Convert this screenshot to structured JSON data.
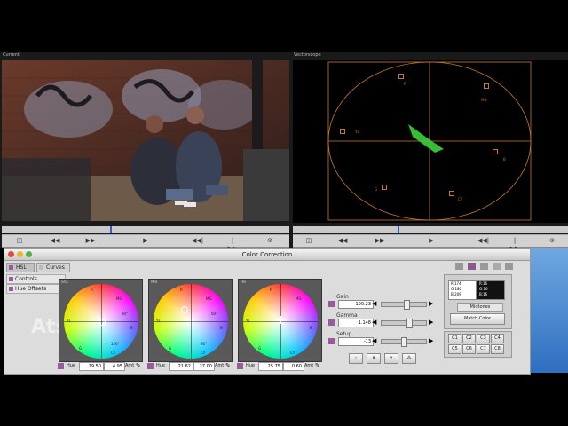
{
  "viewer": {
    "current_label": "Current",
    "vectorscope_label": "Vectorscope"
  },
  "controls": {
    "left": [
      "◫",
      "◀◀",
      "▶▶",
      "▶",
      "◀◀|",
      "|▶▶",
      "⊘"
    ],
    "right": [
      "◫",
      "◀◀",
      "▶▶",
      "▶",
      "◀◀|",
      "|▶▶",
      "⊘"
    ]
  },
  "color_correction": {
    "title": "Color Correction",
    "tabs": {
      "hsl": "HSL",
      "curves": "Curves"
    },
    "sidebar": {
      "controls": "Controls",
      "hue_offsets": "Hue Offsets"
    },
    "wheels": [
      {
        "label": "Sha",
        "hue_label": "Hue",
        "hue": "29.50",
        "amt": "4.95",
        "amt_label": "Amt"
      },
      {
        "label": "Mid",
        "hue_label": "Hue",
        "hue": "21.62",
        "amt": "27.00",
        "amt_label": "Amt"
      },
      {
        "label": "Hili",
        "hue_label": "Hue",
        "hue": "25.75",
        "amt": "0.60",
        "amt_label": "Amt"
      }
    ],
    "wheel_marks": {
      "r": "R",
      "mg": "MG",
      "yl": "YL",
      "cy": "CY",
      "g": "G",
      "b": "B",
      "deg30": "30°",
      "deg60": "60°",
      "deg90": "90°",
      "deg120": "120°"
    },
    "sliders": {
      "gain": {
        "label": "Gain",
        "value": "100.23"
      },
      "gamma": {
        "label": "Gamma",
        "value": "1.148"
      },
      "setup": {
        "label": "Setup",
        "value": "-13"
      }
    },
    "rgb_readout": {
      "left": [
        "R:174",
        "G:180",
        "B:209"
      ],
      "right": [
        "R:16",
        "G:16",
        "B:16"
      ]
    },
    "midtones_select": "Midtones",
    "match_color": "Match Color",
    "c_buttons": [
      "C1",
      "C2",
      "C3",
      "C4",
      "C5",
      "C6",
      "C7",
      "C8"
    ],
    "bottom_icons": [
      "⟂",
      "⬇",
      "⇡",
      "⁂"
    ]
  },
  "vectorscope_labels": [
    "R",
    "MG",
    "YL",
    "B",
    "G",
    "CY"
  ],
  "watermark": "Ats"
}
